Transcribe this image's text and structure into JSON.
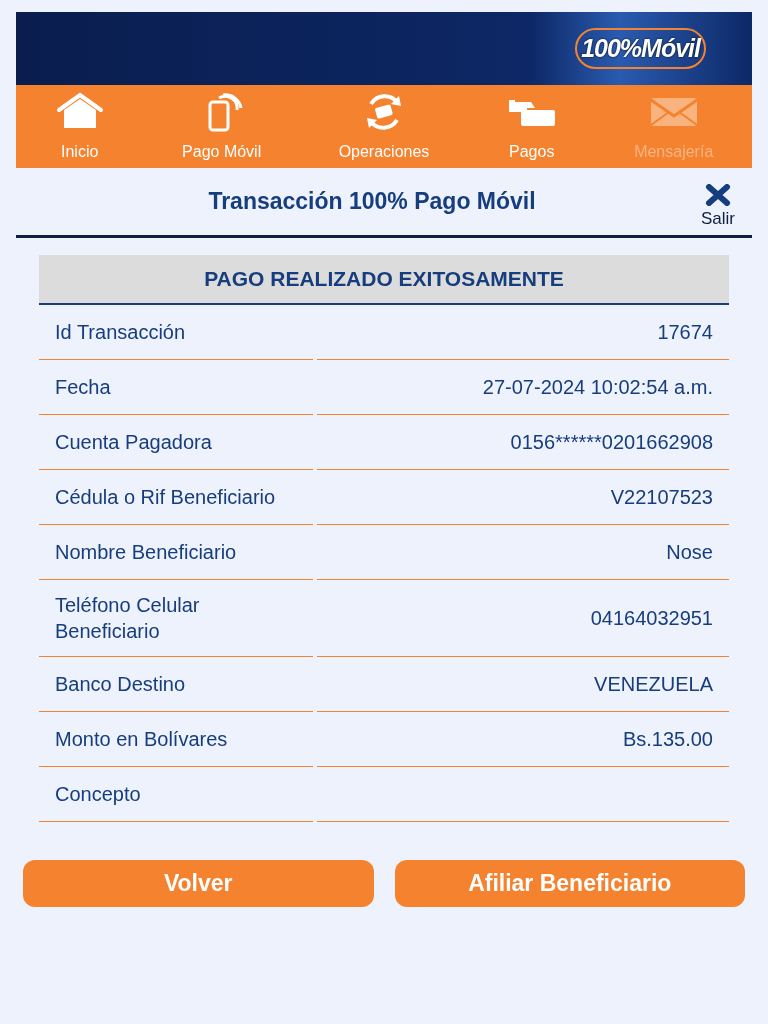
{
  "header": {
    "logo": "100%Móvil"
  },
  "nav": [
    {
      "label": "Inicio",
      "kind": "home",
      "disabled": false
    },
    {
      "label": "Pago Móvil",
      "kind": "phone",
      "disabled": false
    },
    {
      "label": "Operaciones",
      "kind": "exchange",
      "disabled": false
    },
    {
      "label": "Pagos",
      "kind": "payment",
      "disabled": false
    },
    {
      "label": "Mensajería",
      "kind": "mail",
      "disabled": true
    }
  ],
  "title": "Transacción 100% Pago Móvil",
  "exit": {
    "label": "Salir"
  },
  "table": {
    "heading": "PAGO REALIZADO EXITOSAMENTE",
    "rows": [
      {
        "label": "Id Transacción",
        "value": "17674"
      },
      {
        "label": "Fecha",
        "value": "27-07-2024 10:02:54 a.m."
      },
      {
        "label": "Cuenta Pagadora",
        "value": "0156******0201662908"
      },
      {
        "label": "Cédula o Rif Beneficiario",
        "value": "V22107523"
      },
      {
        "label": "Nombre Beneficiario",
        "value": "Nose"
      },
      {
        "label": "Teléfono Celular Beneficiario",
        "value": "04164032951"
      },
      {
        "label": "Banco Destino",
        "value": "VENEZUELA"
      },
      {
        "label": "Monto en Bolívares",
        "value": "Bs.135.00"
      },
      {
        "label": "Concepto"
      }
    ]
  },
  "buttons": [
    "Volver",
    "Afiliar Beneficiario"
  ]
}
